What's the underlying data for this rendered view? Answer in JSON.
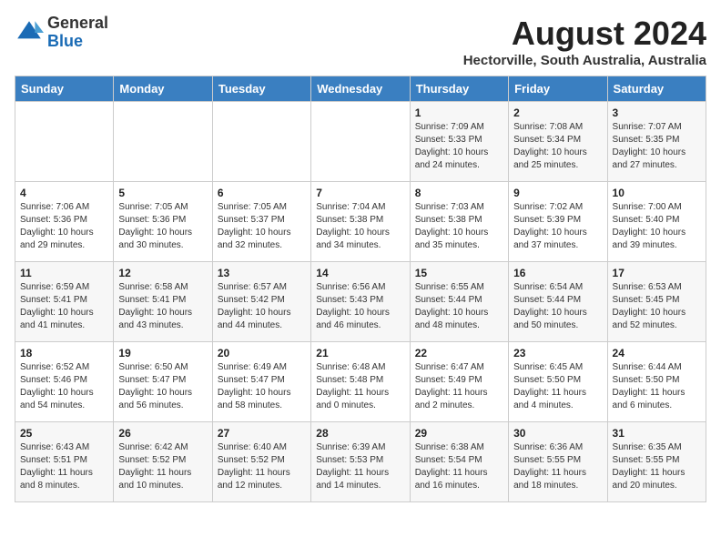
{
  "header": {
    "logo_line1": "General",
    "logo_line2": "Blue",
    "month_year": "August 2024",
    "location": "Hectorville, South Australia, Australia"
  },
  "days_of_week": [
    "Sunday",
    "Monday",
    "Tuesday",
    "Wednesday",
    "Thursday",
    "Friday",
    "Saturday"
  ],
  "weeks": [
    [
      {
        "day": "",
        "content": ""
      },
      {
        "day": "",
        "content": ""
      },
      {
        "day": "",
        "content": ""
      },
      {
        "day": "",
        "content": ""
      },
      {
        "day": "1",
        "content": "Sunrise: 7:09 AM\nSunset: 5:33 PM\nDaylight: 10 hours\nand 24 minutes."
      },
      {
        "day": "2",
        "content": "Sunrise: 7:08 AM\nSunset: 5:34 PM\nDaylight: 10 hours\nand 25 minutes."
      },
      {
        "day": "3",
        "content": "Sunrise: 7:07 AM\nSunset: 5:35 PM\nDaylight: 10 hours\nand 27 minutes."
      }
    ],
    [
      {
        "day": "4",
        "content": "Sunrise: 7:06 AM\nSunset: 5:36 PM\nDaylight: 10 hours\nand 29 minutes."
      },
      {
        "day": "5",
        "content": "Sunrise: 7:05 AM\nSunset: 5:36 PM\nDaylight: 10 hours\nand 30 minutes."
      },
      {
        "day": "6",
        "content": "Sunrise: 7:05 AM\nSunset: 5:37 PM\nDaylight: 10 hours\nand 32 minutes."
      },
      {
        "day": "7",
        "content": "Sunrise: 7:04 AM\nSunset: 5:38 PM\nDaylight: 10 hours\nand 34 minutes."
      },
      {
        "day": "8",
        "content": "Sunrise: 7:03 AM\nSunset: 5:38 PM\nDaylight: 10 hours\nand 35 minutes."
      },
      {
        "day": "9",
        "content": "Sunrise: 7:02 AM\nSunset: 5:39 PM\nDaylight: 10 hours\nand 37 minutes."
      },
      {
        "day": "10",
        "content": "Sunrise: 7:00 AM\nSunset: 5:40 PM\nDaylight: 10 hours\nand 39 minutes."
      }
    ],
    [
      {
        "day": "11",
        "content": "Sunrise: 6:59 AM\nSunset: 5:41 PM\nDaylight: 10 hours\nand 41 minutes."
      },
      {
        "day": "12",
        "content": "Sunrise: 6:58 AM\nSunset: 5:41 PM\nDaylight: 10 hours\nand 43 minutes."
      },
      {
        "day": "13",
        "content": "Sunrise: 6:57 AM\nSunset: 5:42 PM\nDaylight: 10 hours\nand 44 minutes."
      },
      {
        "day": "14",
        "content": "Sunrise: 6:56 AM\nSunset: 5:43 PM\nDaylight: 10 hours\nand 46 minutes."
      },
      {
        "day": "15",
        "content": "Sunrise: 6:55 AM\nSunset: 5:44 PM\nDaylight: 10 hours\nand 48 minutes."
      },
      {
        "day": "16",
        "content": "Sunrise: 6:54 AM\nSunset: 5:44 PM\nDaylight: 10 hours\nand 50 minutes."
      },
      {
        "day": "17",
        "content": "Sunrise: 6:53 AM\nSunset: 5:45 PM\nDaylight: 10 hours\nand 52 minutes."
      }
    ],
    [
      {
        "day": "18",
        "content": "Sunrise: 6:52 AM\nSunset: 5:46 PM\nDaylight: 10 hours\nand 54 minutes."
      },
      {
        "day": "19",
        "content": "Sunrise: 6:50 AM\nSunset: 5:47 PM\nDaylight: 10 hours\nand 56 minutes."
      },
      {
        "day": "20",
        "content": "Sunrise: 6:49 AM\nSunset: 5:47 PM\nDaylight: 10 hours\nand 58 minutes."
      },
      {
        "day": "21",
        "content": "Sunrise: 6:48 AM\nSunset: 5:48 PM\nDaylight: 11 hours\nand 0 minutes."
      },
      {
        "day": "22",
        "content": "Sunrise: 6:47 AM\nSunset: 5:49 PM\nDaylight: 11 hours\nand 2 minutes."
      },
      {
        "day": "23",
        "content": "Sunrise: 6:45 AM\nSunset: 5:50 PM\nDaylight: 11 hours\nand 4 minutes."
      },
      {
        "day": "24",
        "content": "Sunrise: 6:44 AM\nSunset: 5:50 PM\nDaylight: 11 hours\nand 6 minutes."
      }
    ],
    [
      {
        "day": "25",
        "content": "Sunrise: 6:43 AM\nSunset: 5:51 PM\nDaylight: 11 hours\nand 8 minutes."
      },
      {
        "day": "26",
        "content": "Sunrise: 6:42 AM\nSunset: 5:52 PM\nDaylight: 11 hours\nand 10 minutes."
      },
      {
        "day": "27",
        "content": "Sunrise: 6:40 AM\nSunset: 5:52 PM\nDaylight: 11 hours\nand 12 minutes."
      },
      {
        "day": "28",
        "content": "Sunrise: 6:39 AM\nSunset: 5:53 PM\nDaylight: 11 hours\nand 14 minutes."
      },
      {
        "day": "29",
        "content": "Sunrise: 6:38 AM\nSunset: 5:54 PM\nDaylight: 11 hours\nand 16 minutes."
      },
      {
        "day": "30",
        "content": "Sunrise: 6:36 AM\nSunset: 5:55 PM\nDaylight: 11 hours\nand 18 minutes."
      },
      {
        "day": "31",
        "content": "Sunrise: 6:35 AM\nSunset: 5:55 PM\nDaylight: 11 hours\nand 20 minutes."
      }
    ]
  ]
}
